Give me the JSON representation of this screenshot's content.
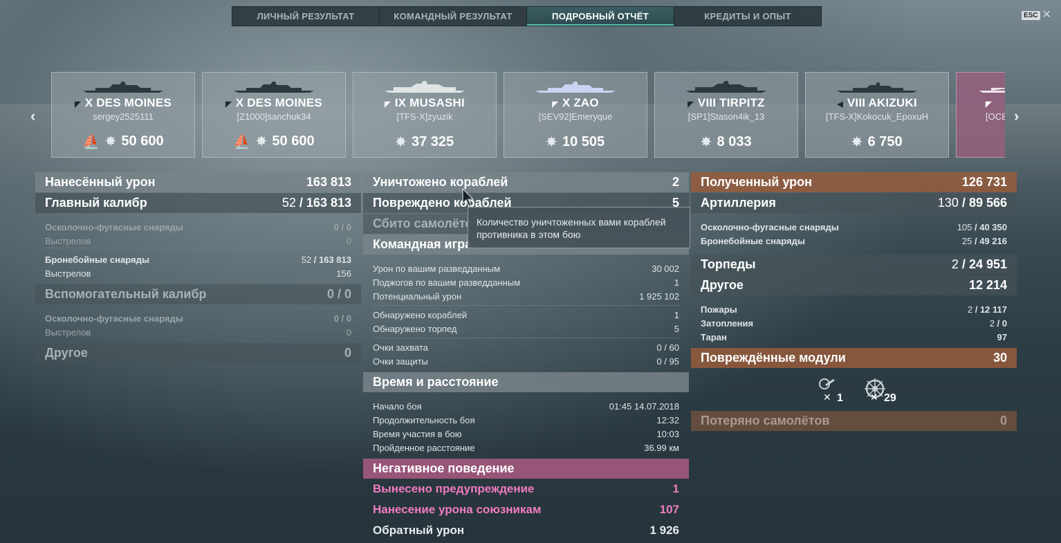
{
  "tabs": [
    "ЛИЧНЫЙ РЕЗУЛЬТАТ",
    "КОМАНДНЫЙ РЕЗУЛЬТАТ",
    "ПОДРОБНЫЙ ОТЧЁТ",
    "КРЕДИТЫ И ОПЫТ"
  ],
  "active_tab": 2,
  "esc_label": "ESC",
  "ships": [
    {
      "name": "X DES MOINES",
      "player": "sergey2525111",
      "score": "50 600",
      "sunk": true
    },
    {
      "name": "X DES MOINES",
      "player": "[Z1000]sanchuk34",
      "score": "50 600",
      "sunk": true
    },
    {
      "name": "IX MUSASHI",
      "player": "[TFS-X]zyuzik",
      "score": "37 325",
      "sunk": false
    },
    {
      "name": "X ZAO",
      "player": "[SEV92]Emeryque",
      "score": "10 505",
      "sunk": false
    },
    {
      "name": "VIII TIRPITZ",
      "player": "[SP1]Stason4ik_13",
      "score": "8 033",
      "sunk": false
    },
    {
      "name": "VIII AKIZUKI",
      "player": "[TFS-X]Kokocuk_EpoxuH",
      "score": "6 750",
      "sunk": false
    },
    {
      "name": "",
      "player": "[OCE",
      "score": "",
      "sunk": false
    }
  ],
  "left": {
    "dealt": {
      "label": "Нанесённый урон",
      "value": "163 813"
    },
    "main": {
      "label": "Главный калибр",
      "hits": "52",
      "value": "163 813"
    },
    "he1": {
      "label": "Осколочно-фугасные снаряды",
      "value": "0 / 0"
    },
    "shots1": {
      "label": "Выстрелов",
      "value": "0"
    },
    "ap": {
      "label": "Бронебойные снаряды",
      "hits": "52",
      "value": "163 813"
    },
    "shots2": {
      "label": "Выстрелов",
      "value": "156"
    },
    "secondary": {
      "label": "Вспомогательный калибр",
      "value": "0 / 0"
    },
    "he2": {
      "label": "Осколочно-фугасные снаряды",
      "value": "0 / 0"
    },
    "shots3": {
      "label": "Выстрелов",
      "value": "0"
    },
    "other": {
      "label": "Другое",
      "value": "0"
    }
  },
  "mid": {
    "destroyed": {
      "label": "Уничтожено кораблей",
      "value": "2"
    },
    "damaged": {
      "label": "Повреждено кораблей",
      "value": "5"
    },
    "planes": {
      "label": "Сбито самолётов",
      "value": ""
    },
    "team": {
      "label": "Командная игра"
    },
    "team_rows": [
      {
        "label": "Урон по вашим разведданным",
        "value": "30 002"
      },
      {
        "label": "Поджогов по вашим разведданным",
        "value": "1"
      },
      {
        "label": "Потенциальный урон",
        "value": "1 925 102"
      },
      {
        "label": "Обнаружено кораблей",
        "value": "1"
      },
      {
        "label": "Обнаружено торпед",
        "value": "5"
      },
      {
        "label": "Очки захвата",
        "value": "0 / 60"
      },
      {
        "label": "Очки защиты",
        "value": "0 / 95"
      }
    ],
    "time": {
      "label": "Время и расстояние"
    },
    "time_rows": [
      {
        "label": "Начало боя",
        "value": "01:45  14.07.2018"
      },
      {
        "label": "Продолжительность боя",
        "value": "12:32"
      },
      {
        "label": "Время участия в бою",
        "value": "10:03"
      },
      {
        "label": "Пройденное расстояние",
        "value": "36.99 км"
      }
    ],
    "negative": {
      "label": "Негативное поведение"
    },
    "warning": {
      "label": "Вынесено предупреждение",
      "value": "1"
    },
    "team_damage": {
      "label": "Нанесение урона союзникам",
      "value": "107"
    },
    "reverse": {
      "label": "Обратный урон",
      "value": "1 926"
    }
  },
  "right": {
    "received": {
      "label": "Полученный урон",
      "value": "126 731"
    },
    "artillery": {
      "label": "Артиллерия",
      "hits": "130",
      "value": "89 566"
    },
    "he": {
      "label": "Осколочно-фугасные снаряды",
      "hits": "105",
      "value": "40 350"
    },
    "ap": {
      "label": "Бронебойные снаряды",
      "hits": "25",
      "value": "49 216"
    },
    "torp": {
      "label": "Торпеды",
      "hits": "2",
      "value": "24 951"
    },
    "other": {
      "label": "Другое",
      "value": "12 214"
    },
    "fires": {
      "label": "Пожары",
      "hits": "2",
      "value": "12 117"
    },
    "floods": {
      "label": "Затопления",
      "hits": "2",
      "value": "0"
    },
    "ram": {
      "label": "Таран",
      "value": "97"
    },
    "modules": {
      "label": "Повреждённые модули",
      "value": "30"
    },
    "module_counts": {
      "guns": "1",
      "steering": "29"
    },
    "planes_lost": {
      "label": "Потеряно самолётов",
      "value": "0"
    }
  },
  "tooltip": "Количество уничтоженных вами кораблей противника в этом бою"
}
